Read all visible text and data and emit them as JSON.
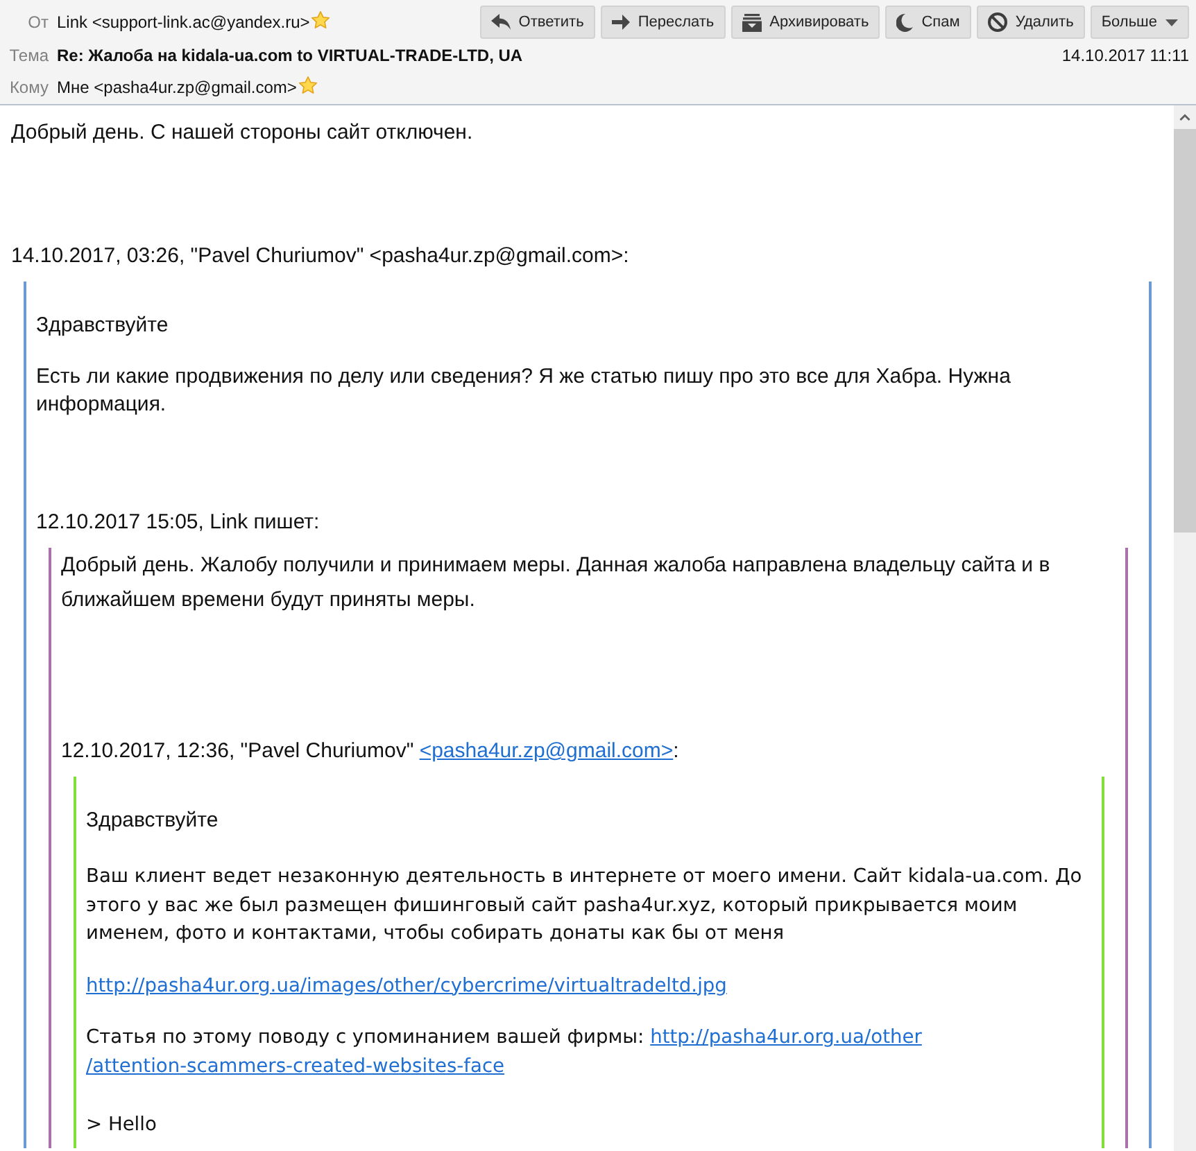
{
  "toolbar": {
    "buttons": [
      {
        "kind": "reply",
        "label": "Ответить"
      },
      {
        "kind": "forward",
        "label": "Переслать"
      },
      {
        "kind": "archive",
        "label": "Архивировать"
      },
      {
        "kind": "spam",
        "label": "Спам"
      },
      {
        "kind": "delete",
        "label": "Удалить"
      },
      {
        "kind": "more",
        "label": "Больше"
      }
    ]
  },
  "header": {
    "fields": [
      {
        "kind": "contact",
        "label": "От",
        "value": "Link <support-link.ac@yandex.ru>"
      },
      {
        "kind": "subject",
        "label": "Тема",
        "value": "Re: Жалоба на kidala-ua.com to VIRTUAL-TRADE-LTD, UA"
      },
      {
        "kind": "contact",
        "label": "Кому",
        "value": "Мне <pasha4ur.zp@gmail.com>"
      }
    ],
    "date": "14.10.2017 11:11"
  },
  "message": {
    "blocks": [
      {
        "kind": "text",
        "text": "Добрый день. С нашей стороны сайт отключен."
      },
      {
        "kind": "attribution",
        "text": "14.10.2017, 03:26, \"Pavel Churiumov\" <pasha4ur.zp@gmail.com>:"
      },
      {
        "kind": "quote",
        "blocks": [
          {
            "kind": "greeting",
            "text": "Здравствуйте"
          },
          {
            "kind": "text",
            "text": "Есть ли какие продвижения по делу или сведения? Я же статью пишу про это все для Хабра. Нужна информация."
          },
          {
            "kind": "attribution",
            "text": "12.10.2017 15:05, Link пишет:"
          },
          {
            "kind": "quote",
            "blocks": [
              {
                "kind": "text",
                "text": "Добрый день. Жалобу получили и принимаем меры. Данная жалоба направлена владельцу сайта и в ближайшем времени будут приняты меры."
              },
              {
                "kind": "attribution",
                "segments": [
                  {
                    "kind": "plain",
                    "text": "12.10.2017, 12:36, \"Pavel Churiumov\" "
                  },
                  {
                    "kind": "link",
                    "text": "<pasha4ur.zp@gmail.com>"
                  },
                  {
                    "kind": "plain",
                    "text": ":"
                  }
                ]
              },
              {
                "kind": "quote",
                "blocks": [
                  {
                    "kind": "greeting",
                    "text": "Здравствуйте"
                  },
                  {
                    "kind": "text",
                    "text": "Ваш клиент ведет незаконную деятельность в интернете от моего имени. Сайт kidala-ua.com. До этого у вас же был размещен фишинговый сайт pasha4ur.xyz, который прикрывается моим именем, фото и контактами, чтобы собирать донаты как бы от меня"
                  },
                  {
                    "kind": "link",
                    "text": "http://pasha4ur.org.ua/images/other/cybercrime/virtualtradeltd.jpg"
                  },
                  {
                    "kind": "text",
                    "segments": [
                      {
                        "kind": "plain",
                        "text": "Статья по этому поводу с упоминанием вашей фирмы: "
                      },
                      {
                        "kind": "link",
                        "text": "http://pasha4ur.org.ua/other"
                      },
                      {
                        "kind": "line_break"
                      },
                      {
                        "kind": "link",
                        "text": "/attention-scammers-created-websites-face"
                      }
                    ]
                  },
                  {
                    "kind": "text",
                    "text": "> Hello"
                  }
                ]
              }
            ]
          }
        ]
      }
    ]
  }
}
